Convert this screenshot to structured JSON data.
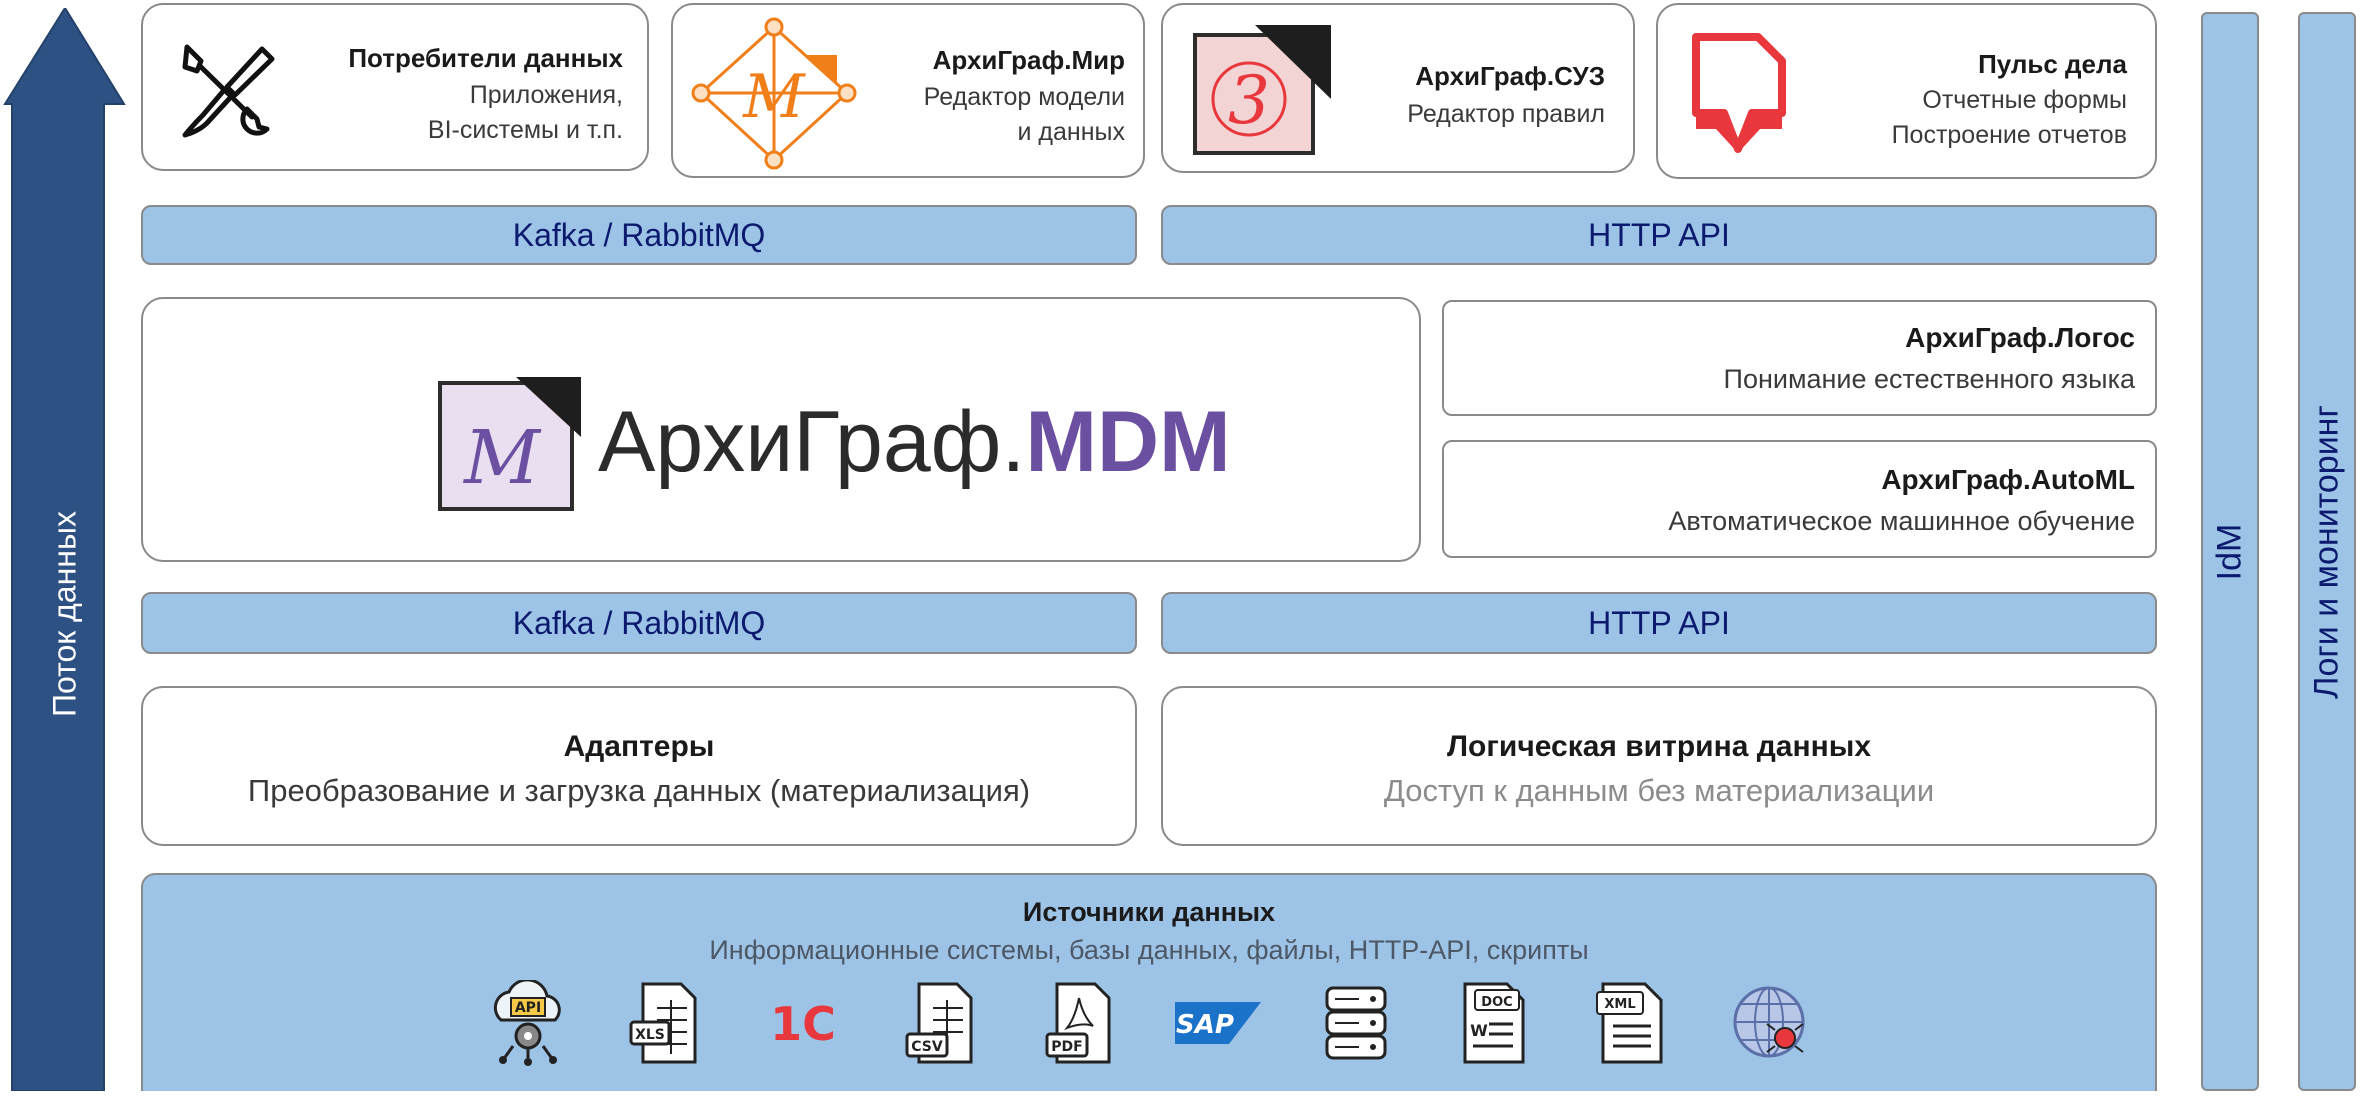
{
  "left_arrow": {
    "label": "Поток данных",
    "color": "#2e5184"
  },
  "right_bars": {
    "idm": "IdM",
    "logs": "Логи и мониторинг"
  },
  "top_cards": [
    {
      "title": "Потребители данных",
      "lines": [
        "Приложения,",
        "BI-системы и т.п."
      ],
      "icon": "tools-icon"
    },
    {
      "title": "АрхиГраф.Мир",
      "lines": [
        "Редактор модели",
        "и данных"
      ],
      "icon": "archigraph-mir-logo"
    },
    {
      "title": "АрхиГраф.СУЗ",
      "lines": [
        "Редактор правил"
      ],
      "icon": "archigraph-suz-logo"
    },
    {
      "title": "Пульс дела",
      "lines": [
        "Отчетные формы",
        "Построение отчетов"
      ],
      "icon": "puls-dela-logo"
    }
  ],
  "bars_top": {
    "left": "Kafka / RabbitMQ",
    "right": "HTTP API"
  },
  "mdm": {
    "logo_text_prefix": "АрхиГраф.",
    "logo_text_suffix": "MDM"
  },
  "logos_card": {
    "title": "АрхиГраф.Логос",
    "sub": "Понимание естественного языка"
  },
  "automl_card": {
    "title": "АрхиГраф.AutoML",
    "sub": "Автоматическое машинное обучение"
  },
  "bars_bottom": {
    "left": "Kafka / RabbitMQ",
    "right": "HTTP API"
  },
  "adapters": {
    "title": "Адаптеры",
    "sub": "Преобразование и загрузка данных (материализация)"
  },
  "logical": {
    "title": "Логическая витрина данных",
    "sub": "Доступ к данным без материализации"
  },
  "sources": {
    "title": "Источники данных",
    "sub": "Информационные системы, базы данных, файлы, HTTP-API, скрипты",
    "icons": [
      {
        "name": "api-icon",
        "label": "API"
      },
      {
        "name": "xls-file-icon",
        "label": "XLS"
      },
      {
        "name": "1c-logo",
        "label": "1С"
      },
      {
        "name": "csv-file-icon",
        "label": "CSV"
      },
      {
        "name": "pdf-file-icon",
        "label": "PDF"
      },
      {
        "name": "sap-logo",
        "label": "SAP"
      },
      {
        "name": "database-icon",
        "label": ""
      },
      {
        "name": "doc-file-icon",
        "label": "DOC"
      },
      {
        "name": "xml-file-icon",
        "label": "XML"
      },
      {
        "name": "web-crawler-icon",
        "label": ""
      }
    ]
  },
  "colors": {
    "accent_blue": "#9dc3e6",
    "arrow_blue": "#2e5184",
    "mdm_purple": "#6b4fa0",
    "orange": "#f07f1a",
    "red": "#e8383d"
  }
}
